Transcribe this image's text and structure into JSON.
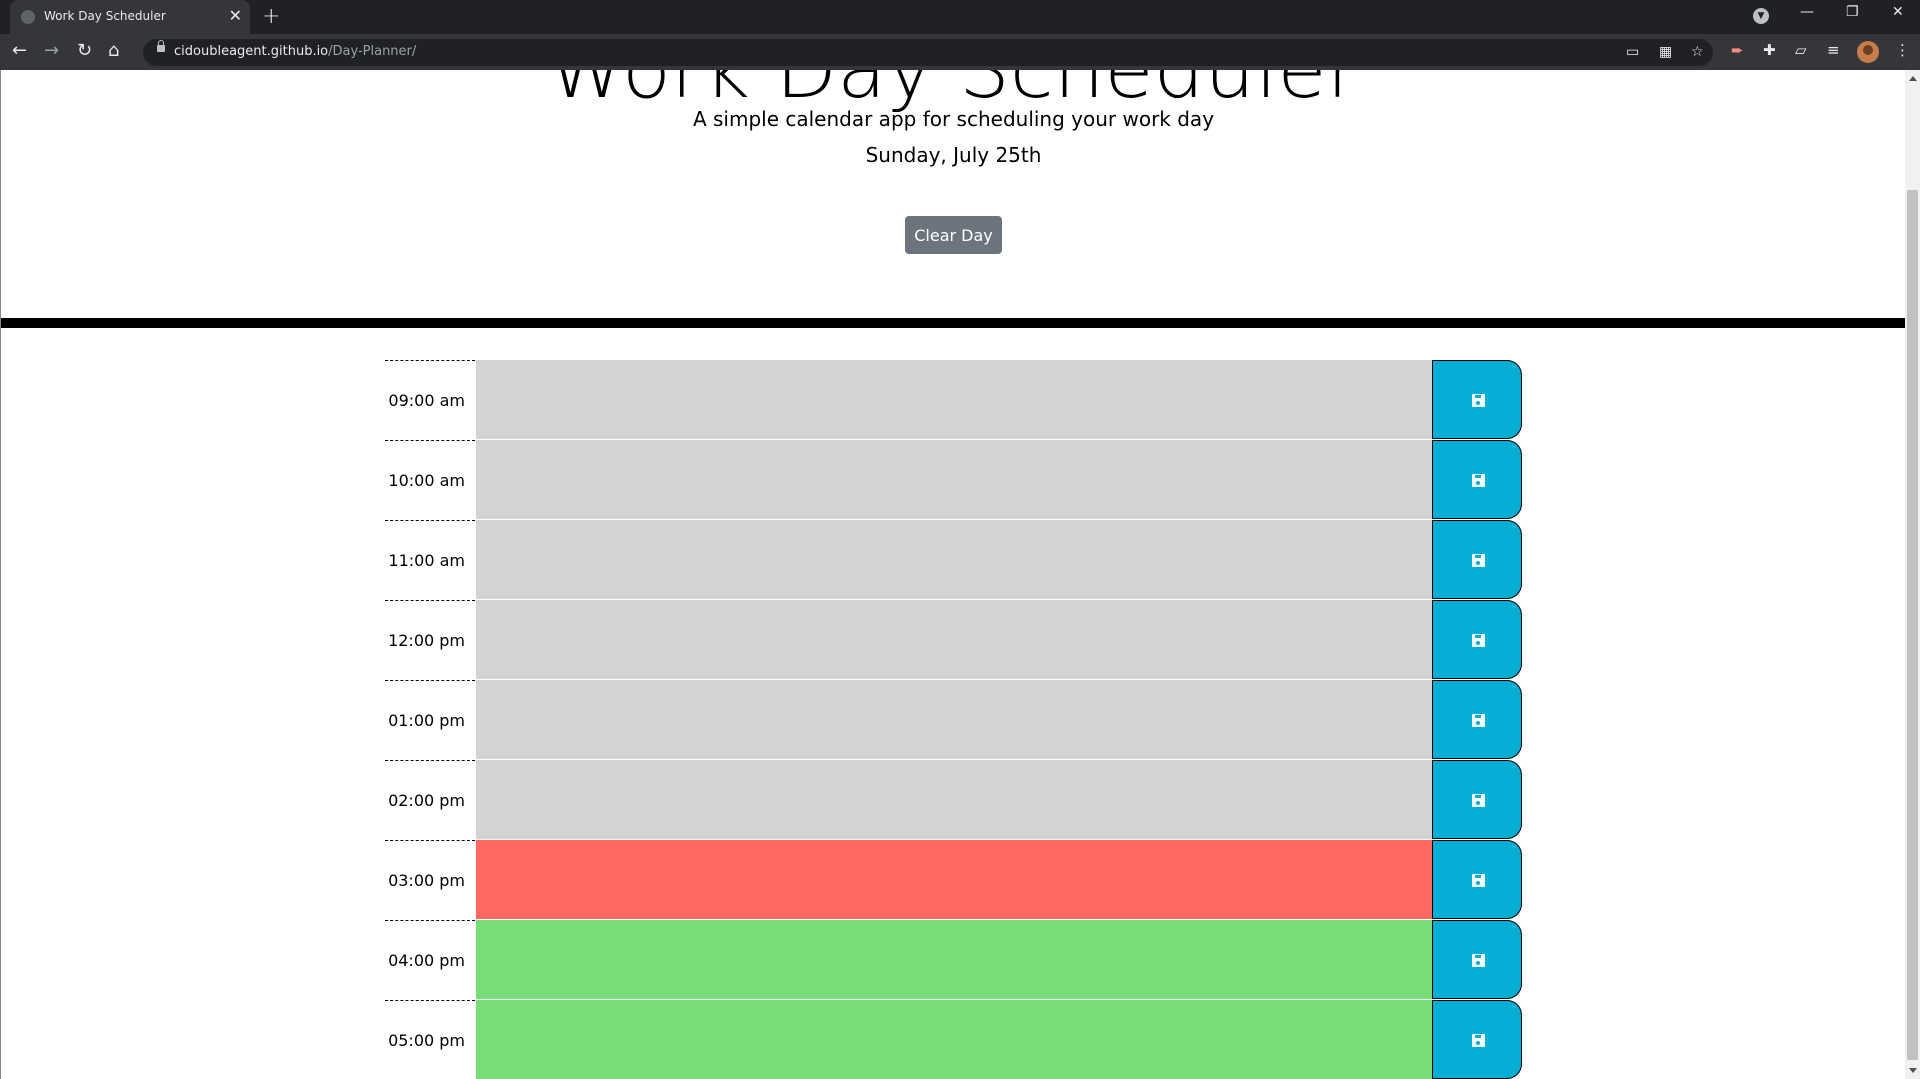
{
  "browser": {
    "tab_title": "Work Day Scheduler",
    "url_host": "cidoubleagent.github.io",
    "url_path": "/Day-Planner/"
  },
  "header": {
    "title": "Work Day Scheduler",
    "lead": "A simple calendar app for scheduling your work day",
    "current_day": "Sunday, July 25th",
    "clear_label": "Clear Day"
  },
  "colors": {
    "past": "#d3d3d3",
    "present": "#ff6961",
    "future": "#77dd77",
    "save_button": "#06aed5",
    "clear_button": "#6c757d"
  },
  "schedule": {
    "rows": [
      {
        "hour": "09:00 am",
        "text": "",
        "state": "past"
      },
      {
        "hour": "10:00 am",
        "text": "",
        "state": "past"
      },
      {
        "hour": "11:00 am",
        "text": "",
        "state": "past"
      },
      {
        "hour": "12:00 pm",
        "text": "",
        "state": "past"
      },
      {
        "hour": "01:00 pm",
        "text": "",
        "state": "past"
      },
      {
        "hour": "02:00 pm",
        "text": "",
        "state": "past"
      },
      {
        "hour": "03:00 pm",
        "text": "",
        "state": "present"
      },
      {
        "hour": "04:00 pm",
        "text": "",
        "state": "future"
      },
      {
        "hour": "05:00 pm",
        "text": "",
        "state": "future"
      }
    ]
  }
}
